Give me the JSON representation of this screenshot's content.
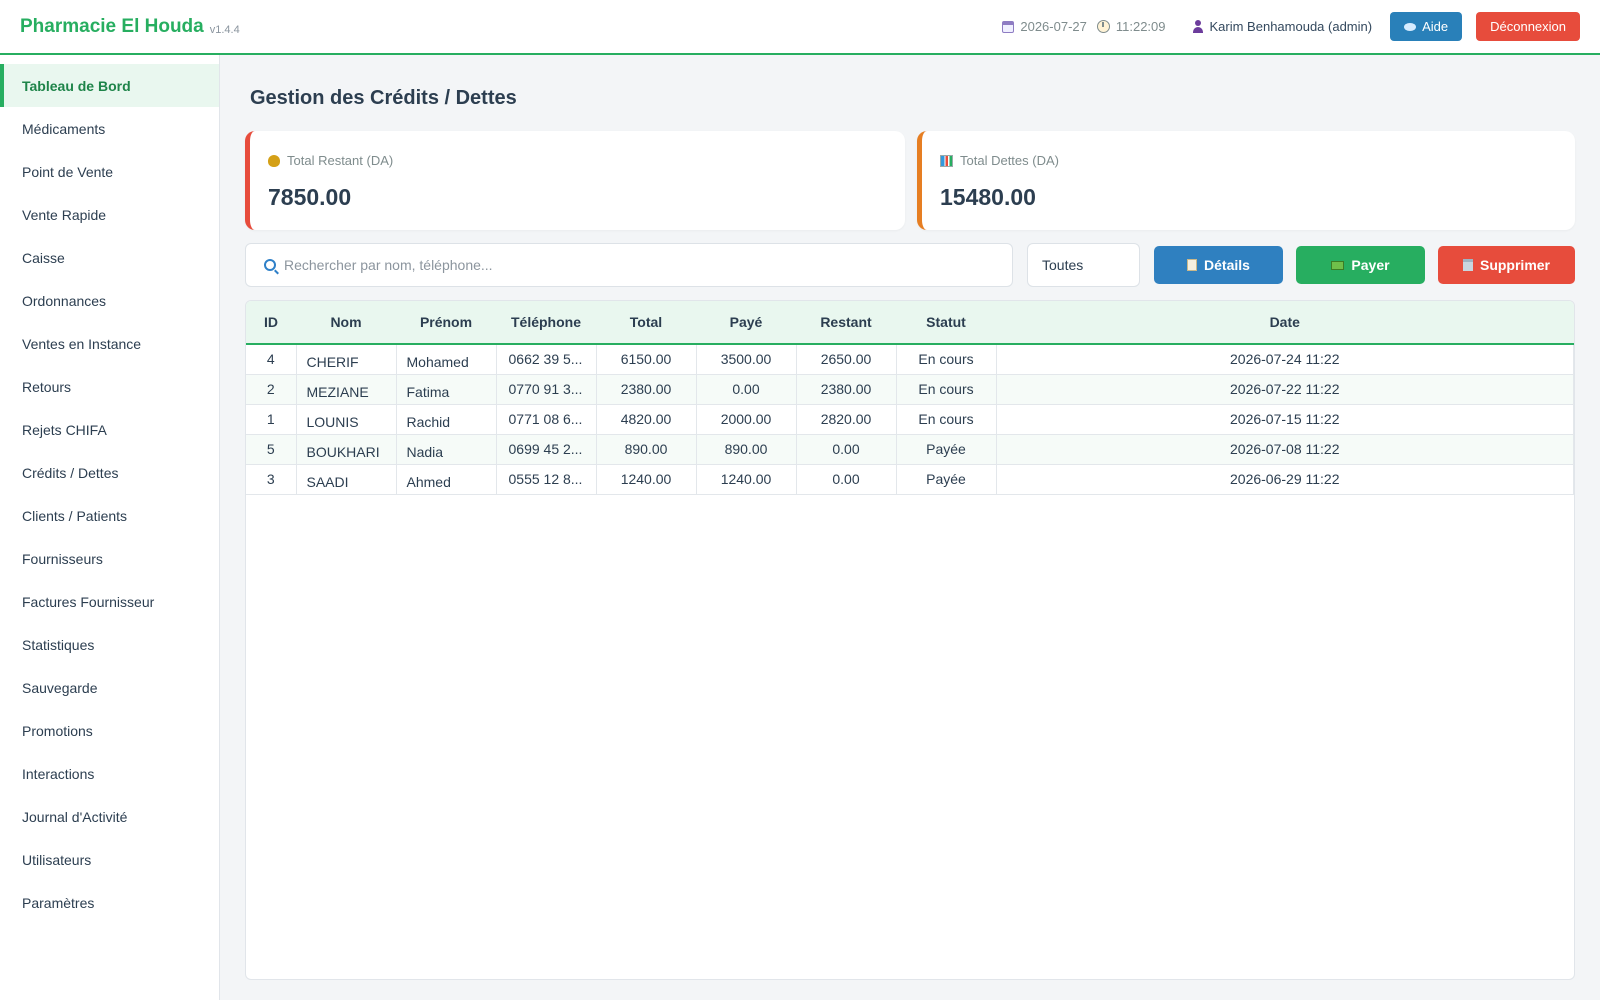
{
  "header": {
    "brand": "Pharmacie El Houda",
    "version": "v1.4.4",
    "date": "2026-07-27",
    "time": "11:22:09",
    "user": "Karim Benhamouda (admin)",
    "help_label": "Aide",
    "logout_label": "Déconnexion",
    "accent_color": "#27ae60"
  },
  "sidebar": {
    "items": [
      {
        "label": "Tableau de Bord",
        "active": true
      },
      {
        "label": "Médicaments"
      },
      {
        "label": "Point de Vente"
      },
      {
        "label": "Vente Rapide"
      },
      {
        "label": "Caisse"
      },
      {
        "label": "Ordonnances"
      },
      {
        "label": "Ventes en Instance"
      },
      {
        "label": "Retours"
      },
      {
        "label": "Rejets CHIFA"
      },
      {
        "label": "Crédits / Dettes"
      },
      {
        "label": "Clients / Patients"
      },
      {
        "label": "Fournisseurs"
      },
      {
        "label": "Factures Fournisseur"
      },
      {
        "label": "Statistiques"
      },
      {
        "label": "Sauvegarde"
      },
      {
        "label": "Promotions"
      },
      {
        "label": "Interactions"
      },
      {
        "label": "Journal d'Activité"
      },
      {
        "label": "Utilisateurs"
      },
      {
        "label": "Paramètres"
      }
    ]
  },
  "main": {
    "title": "Gestion des Crédits / Dettes",
    "cards": {
      "remaining": {
        "label": "Total Restant (DA)",
        "value": "7850.00",
        "color": "#e74c3c",
        "icon": "money-bag-icon"
      },
      "debts": {
        "label": "Total Dettes (DA)",
        "value": "15480.00",
        "color": "#e67e22",
        "icon": "bar-chart-icon"
      }
    },
    "search": {
      "placeholder": "Rechercher par nom, téléphone..."
    },
    "filter": {
      "value": "Toutes"
    },
    "actions": {
      "details_label": "Détails",
      "pay_label": "Payer",
      "delete_label": "Supprimer"
    },
    "table": {
      "columns": [
        "ID",
        "Nom",
        "Prénom",
        "Téléphone",
        "Total",
        "Payé",
        "Restant",
        "Statut",
        "Date"
      ],
      "rows": [
        {
          "id": "4",
          "nom": "CHERIF",
          "prenom": "Mohamed",
          "tel": "0662 39 5...",
          "total": "6150.00",
          "paye": "3500.00",
          "restant": "2650.00",
          "statut": "En cours",
          "date": "2026-07-24 11:22"
        },
        {
          "id": "2",
          "nom": "MEZIANE",
          "prenom": "Fatima",
          "tel": "0770 91 3...",
          "total": "2380.00",
          "paye": "0.00",
          "restant": "2380.00",
          "statut": "En cours",
          "date": "2026-07-22 11:22"
        },
        {
          "id": "1",
          "nom": "LOUNIS",
          "prenom": "Rachid",
          "tel": "0771 08 6...",
          "total": "4820.00",
          "paye": "2000.00",
          "restant": "2820.00",
          "statut": "En cours",
          "date": "2026-07-15 11:22"
        },
        {
          "id": "5",
          "nom": "BOUKHARI",
          "prenom": "Nadia",
          "tel": "0699 45 2...",
          "total": "890.00",
          "paye": "890.00",
          "restant": "0.00",
          "statut": "Payée",
          "date": "2026-07-08 11:22"
        },
        {
          "id": "3",
          "nom": "SAADI",
          "prenom": "Ahmed",
          "tel": "0555 12 8...",
          "total": "1240.00",
          "paye": "1240.00",
          "restant": "0.00",
          "statut": "Payée",
          "date": "2026-06-29 11:22"
        }
      ]
    }
  }
}
